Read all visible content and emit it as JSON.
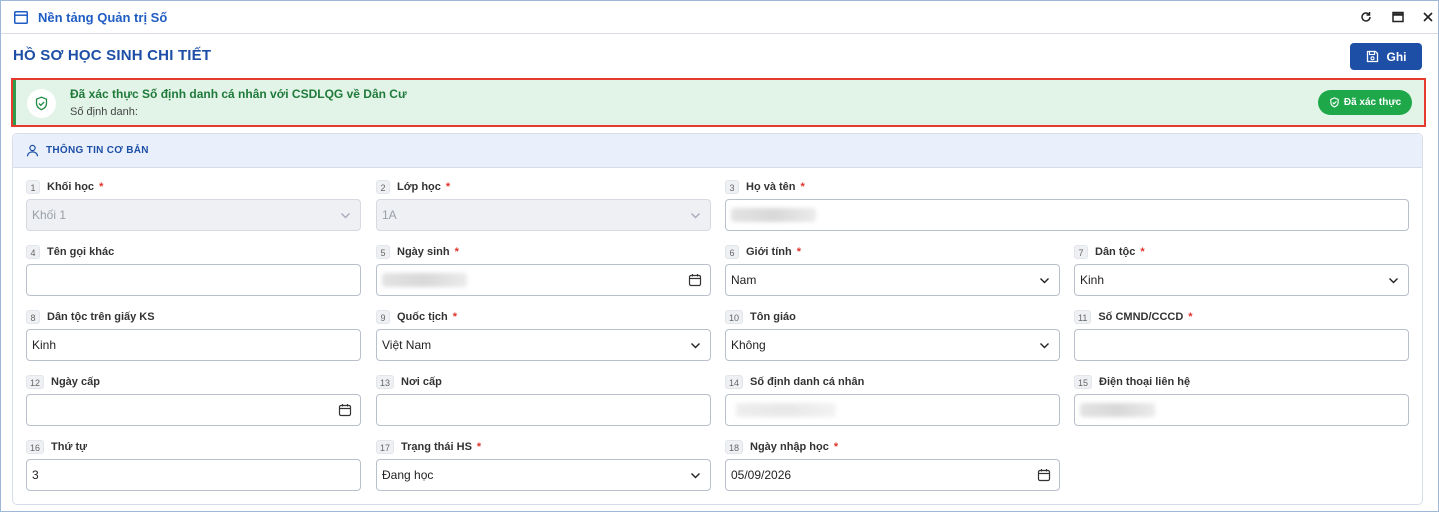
{
  "window": {
    "title": "Nền tảng Quản trị Số",
    "controls": {
      "refresh_icon": "refresh-icon",
      "maximize_icon": "maximize-icon",
      "close_icon": "close-icon"
    }
  },
  "page": {
    "title": "HỒ SƠ HỌC SINH CHI TIẾT",
    "save_label": "Ghi"
  },
  "verification": {
    "title": "Đã xác thực Số định danh cá nhân với CSDLQG về Dân Cư",
    "subtitle": "Số định danh:",
    "badge_label": "Đã xác thực",
    "accent": "#1fa84a",
    "border_color": "#e53b2f"
  },
  "section": {
    "title": "THÔNG TIN CƠ BẢN"
  },
  "fields": {
    "f1": {
      "num": "1",
      "label": "Khối học",
      "required": "*",
      "value": "Khối 1"
    },
    "f2": {
      "num": "2",
      "label": "Lớp học",
      "required": "*",
      "value": "1A"
    },
    "f3": {
      "num": "3",
      "label": "Họ và tên",
      "required": "*",
      "value": ""
    },
    "f4": {
      "num": "4",
      "label": "Tên gọi khác",
      "value": ""
    },
    "f5": {
      "num": "5",
      "label": "Ngày sinh",
      "required": "*",
      "value": ""
    },
    "f6": {
      "num": "6",
      "label": "Giới tính",
      "required": "*",
      "value": "Nam"
    },
    "f7": {
      "num": "7",
      "label": "Dân tộc",
      "required": "*",
      "value": "Kinh"
    },
    "f8": {
      "num": "8",
      "label": "Dân tộc trên giấy KS",
      "value": "Kinh"
    },
    "f9": {
      "num": "9",
      "label": "Quốc tịch",
      "required": "*",
      "value": "Việt Nam"
    },
    "f10": {
      "num": "10",
      "label": "Tôn giáo",
      "value": "Không"
    },
    "f11": {
      "num": "11",
      "label": "Số CMND/CCCD",
      "required": "*",
      "value": ""
    },
    "f12": {
      "num": "12",
      "label": "Ngày cấp",
      "value": ""
    },
    "f13": {
      "num": "13",
      "label": "Nơi cấp",
      "value": ""
    },
    "f14": {
      "num": "14",
      "label": "Số định danh cá nhân",
      "value": ""
    },
    "f15": {
      "num": "15",
      "label": "Điện thoại liên hệ",
      "value": ""
    },
    "f16": {
      "num": "16",
      "label": "Thứ tự",
      "value": "3"
    },
    "f17": {
      "num": "17",
      "label": "Trạng thái HS",
      "required": "*",
      "value": "Đang học"
    },
    "f18": {
      "num": "18",
      "label": "Ngày nhập học",
      "required": "*",
      "value": "05/09/2026"
    }
  }
}
